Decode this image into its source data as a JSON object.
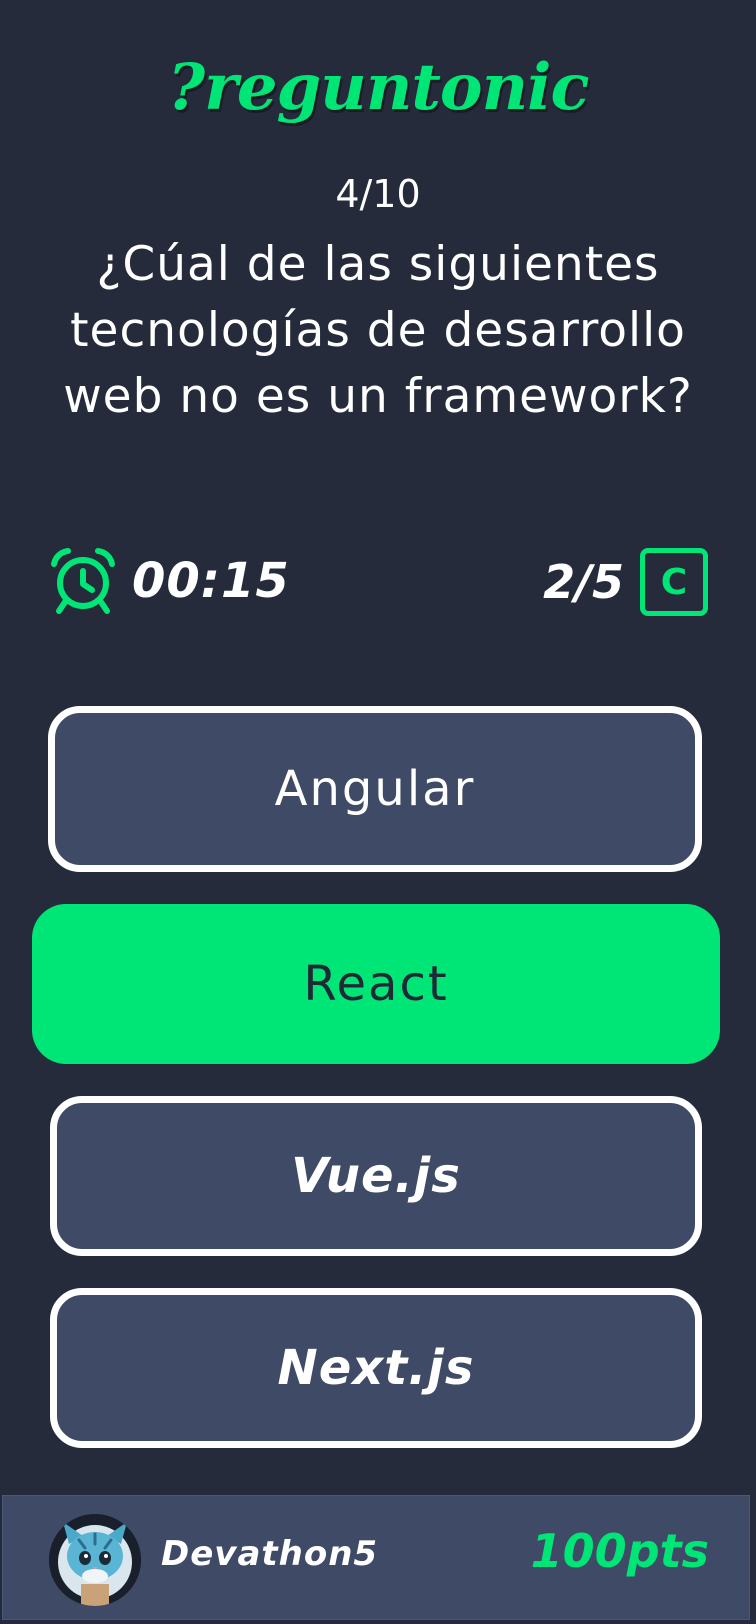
{
  "app": {
    "logo": "?reguntonic"
  },
  "quiz": {
    "counter": "4/10",
    "question": "¿Cúal de las siguientes tecnologías de desarrollo web no es un framework?",
    "timer": "00:15",
    "progress": "2/5",
    "level_badge": "C",
    "options": [
      "Angular",
      "React",
      "Vue.js",
      "Next.js"
    ],
    "selected_option": "React"
  },
  "footer": {
    "username": "Devathon5",
    "points": "100pts"
  },
  "icons": {
    "timer": "alarm-clock-icon",
    "avatar": "cat-avatar"
  },
  "colors": {
    "background": "#252b3b",
    "accent": "#00e676",
    "option_bg": "#3e4a66",
    "selected_text": "#1f2a36"
  }
}
